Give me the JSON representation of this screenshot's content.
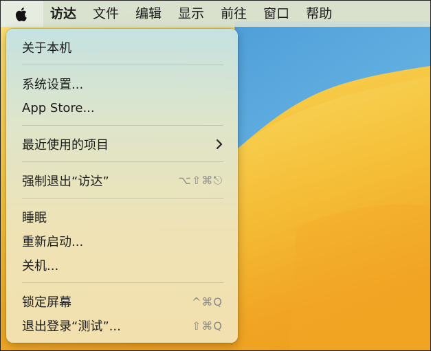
{
  "menubar": {
    "apple_icon": "apple-logo-icon",
    "items": [
      "访达",
      "文件",
      "编辑",
      "显示",
      "前往",
      "窗口",
      "帮助"
    ]
  },
  "apple_menu": {
    "about": "关于本机",
    "system_settings": "系统设置...",
    "app_store": "App Store...",
    "recent_items": "最近使用的项目",
    "recent_items_icon": "chevron-right-icon",
    "force_quit": "强制退出“访达”",
    "force_quit_shortcut": "⌥⇧⌘⎋",
    "sleep": "睡眠",
    "restart": "重新启动...",
    "shutdown": "关机...",
    "lock_screen": "锁定屏幕",
    "lock_screen_shortcut": "^⌘Q",
    "logout": "退出登录“测试”...",
    "logout_shortcut": "⇧⌘Q"
  }
}
